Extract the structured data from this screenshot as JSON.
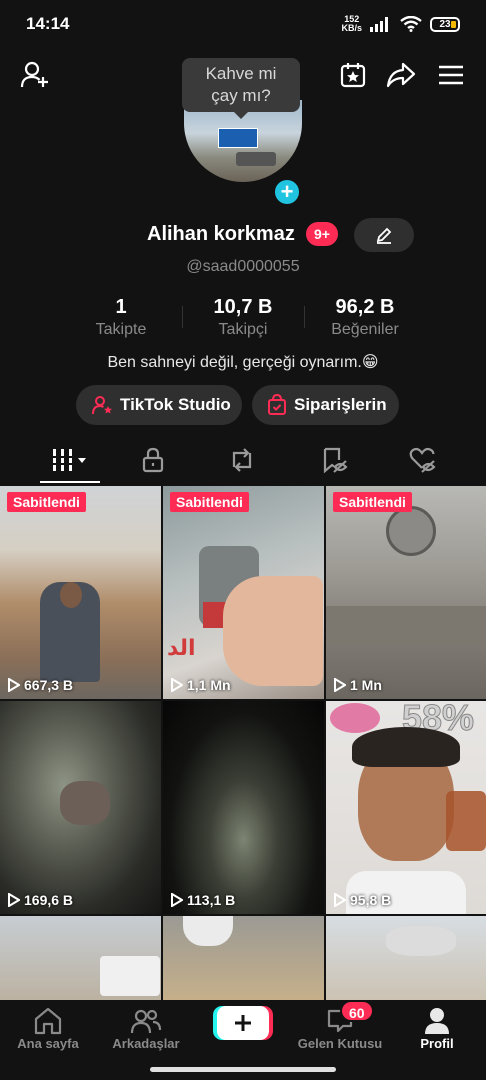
{
  "status_bar": {
    "time": "14:14",
    "net_speed_value": "152",
    "net_speed_unit": "KB/s",
    "battery": "23"
  },
  "tooltip": {
    "line1": "Kahve mi",
    "line2": "çay mı?"
  },
  "profile": {
    "name": "Alihan korkmaz",
    "notification_badge": "9+",
    "handle": "@saad0000055",
    "bio": "Ben sahneyi değil, gerçeği oynarım.😁"
  },
  "stats": [
    {
      "value": "1",
      "label": "Takipte"
    },
    {
      "value": "10,7 B",
      "label": "Takipçi"
    },
    {
      "value": "96,2 B",
      "label": "Beğeniler"
    }
  ],
  "buttons": {
    "studio": "TikTok Studio",
    "orders": "Siparişlerin"
  },
  "videos": [
    {
      "pinned": "Sabitlendi",
      "views": "667,3 B"
    },
    {
      "pinned": "Sabitlendi",
      "views": "1,1 Mn"
    },
    {
      "pinned": "Sabitlendi",
      "views": "1 Mn"
    },
    {
      "pinned": "",
      "views": "169,6 B"
    },
    {
      "pinned": "",
      "views": "113,1 B"
    },
    {
      "pinned": "",
      "views": "95,8 B"
    }
  ],
  "overlay_text": {
    "percent": "58%",
    "arabic": "الد"
  },
  "nav": {
    "home": "Ana sayfa",
    "friends": "Arkadaşlar",
    "inbox": "Gelen Kutusu",
    "inbox_badge": "60",
    "profile": "Profil"
  },
  "colors": {
    "accent": "#fe2c55",
    "cyan": "#25f4ee",
    "background": "#121212"
  }
}
